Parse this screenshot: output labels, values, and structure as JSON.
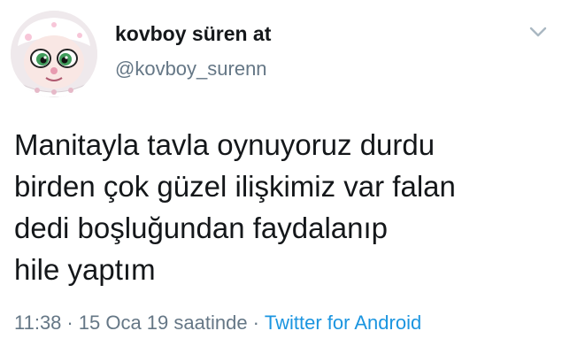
{
  "author": {
    "display_name": "kovboy süren at",
    "handle": "@kovboy_surenn"
  },
  "tweet": {
    "text_lines": [
      "Manitayla tavla oynuyoruz durdu",
      "birden çok güzel ilişkimiz var falan",
      "dedi boşluğundan faydalanıp",
      "hile yaptım"
    ]
  },
  "meta": {
    "time": "11:38",
    "separator": "·",
    "date": "15 Oca 19 saatinde",
    "source": "Twitter for Android"
  },
  "icons": {
    "menu": "chevron-down-icon",
    "avatar": "cartoon-character-avatar"
  },
  "colors": {
    "text": "#14171a",
    "secondary": "#657786",
    "link": "#1b95e0"
  }
}
